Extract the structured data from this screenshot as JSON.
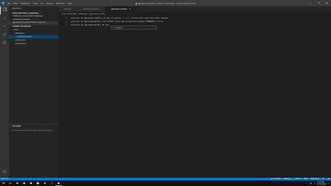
{
  "titlebar": {
    "title": "● gameLoop.batch - Power Automate - Visual Studio Code",
    "menu": [
      "File",
      "Edit",
      "Selection",
      "View",
      "Go",
      "Debug",
      "Terminal",
      "Help"
    ]
  },
  "sidebar": {
    "header": "EXPLORER",
    "open_editors": {
      "header": "OPEN EDITORS 1 UNSAVED",
      "items": [
        "Wallpaper_Script.batch Wallpaper",
        "startupScript.batch",
        "● gameLoop.batch Power Automate"
      ]
    },
    "folder": {
      "header": "POWER AUTOMATE",
      "items": [
        {
          "label": "data",
          "indent": 1,
          "chevron": "›"
        },
        {
          "label": "Wallpaper",
          "indent": 1,
          "chevron": "⌄"
        },
        {
          "label": "gameLoop.batch",
          "indent": 2,
          "chevron": ""
        },
        {
          "label": "startup.bat",
          "indent": 1,
          "chevron": ""
        },
        {
          "label": "settings.json",
          "indent": 1,
          "chevron": ""
        }
      ]
    },
    "outline": {
      "header": "OUTLINE",
      "message": "No symbols found in document 'gameLoop.batch'"
    }
  },
  "tabs": [
    {
      "label": "WB.bat",
      "active": false
    },
    {
      "label": "startupScript.bat",
      "active": false
    },
    {
      "label": "gameLoop.batch",
      "active": true
    }
  ],
  "breadcrumb": "Power Automate › Wallpaper › gameLoop.batch",
  "code": [
    {
      "n": "1",
      "text": "    execute as @a[tag=!setup] at @s if block ~ ~-1 ~ minecraft:red_concrete unless",
      "rest": " ...  run tp @s ~ ~ ~ ..."
    },
    {
      "n": "2",
      "text": "    execute as @a[tag=setup] run effect give @s minecraft:speed 1000000 5 true",
      "rest": ""
    },
    {
      "n": "3",
      "text": "    execute as @a[tag=setup] at @s",
      "rest": ""
    }
  ],
  "suggestion": {
    "label": "speed"
  },
  "statusbar": {
    "left": "⊗ 0 ⚠ 0",
    "right": [
      "Ln 3, Col 33",
      "Spaces: 4",
      "UTF-8",
      "CRLF",
      "Plain Text",
      "☺",
      "🔔"
    ]
  },
  "taskbar": {
    "time": "1:57 PM",
    "date": "7/27/2019"
  }
}
